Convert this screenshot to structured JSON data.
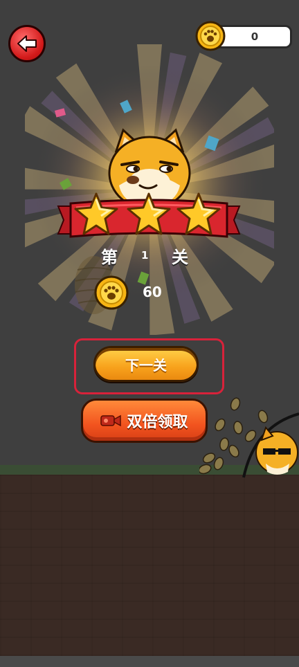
{
  "header": {
    "back_icon": "back-arrow-icon",
    "coin_icon": "paw-coin-icon",
    "coin_count": "0"
  },
  "result": {
    "stars_earned": 3,
    "stars_total": 3,
    "stage_prefix": "第",
    "stage_number": "1",
    "stage_suffix": "关",
    "reward_icon": "paw-coin-icon",
    "reward_amount": "60"
  },
  "actions": {
    "next_label": "下一关",
    "double_label": "双倍领取",
    "double_icon": "video-camera-icon"
  },
  "colors": {
    "next_button": "#f8a21c",
    "double_button": "#f2541f",
    "highlight_box": "#d8223a",
    "ribbon": "#d9262e",
    "star": "#ffc928"
  }
}
